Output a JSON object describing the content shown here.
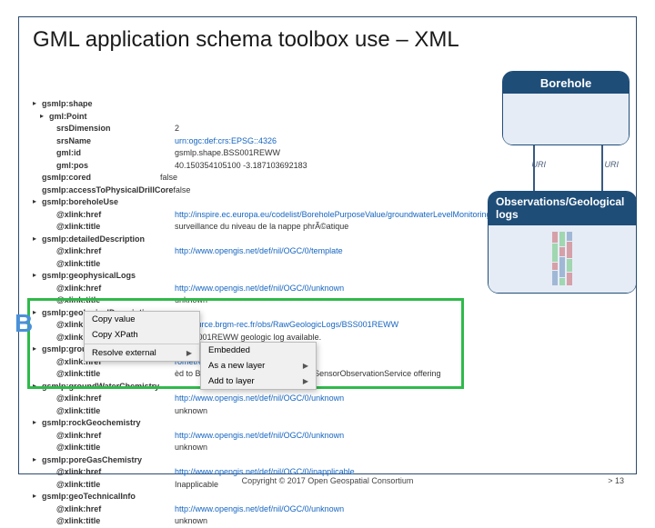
{
  "title": "GML application schema toolbox use – XML",
  "borehole": {
    "label": "Borehole"
  },
  "obs": {
    "label": "Observations/Geological logs"
  },
  "big_b": "B",
  "uri": {
    "l1": "URI",
    "l2": "URI"
  },
  "ctx": {
    "copy_value": "Copy value",
    "copy_xpath": "Copy XPath",
    "resolve_ext": "Resolve external",
    "embedded": "Embedded",
    "new_layer": "As a new layer",
    "add_layer": "Add to layer"
  },
  "attrs": [
    {
      "i": 0,
      "b": "▸",
      "k": "gsmlp:shape",
      "v": ""
    },
    {
      "i": 1,
      "b": "▸",
      "k": "gml:Point",
      "v": ""
    },
    {
      "i": 2,
      "b": "",
      "k": "srsDimension",
      "v": "2"
    },
    {
      "i": 2,
      "b": "",
      "k": "srsName",
      "v": "urn:ogc:def:crs:EPSG::4326",
      "l": true
    },
    {
      "i": 2,
      "b": "",
      "k": "gml:id",
      "v": "gsmlp.shape.BSS001REWW"
    },
    {
      "i": 2,
      "b": "",
      "k": "gml:pos",
      "v": "40.150354105100 -3.187103692183"
    },
    {
      "i": 0,
      "b": "",
      "k": "gsmlp:cored",
      "v": "false"
    },
    {
      "i": 0,
      "b": "",
      "k": "gsmlp:accessToPhysicalDrillCore",
      "v": "false"
    },
    {
      "i": 0,
      "b": "▸",
      "k": "gsmlp:boreholeUse",
      "v": ""
    },
    {
      "i": 2,
      "b": "",
      "k": "@xlink:href",
      "v": "http://inspire.ec.europa.eu/codelist/BoreholePurposeValue/groundwaterLevelMonitoring",
      "l": true
    },
    {
      "i": 2,
      "b": "",
      "k": "@xlink:title",
      "v": "surveillance du niveau de la nappe phrÃ©atique"
    },
    {
      "i": 0,
      "b": "▸",
      "k": "gsmlp:detailedDescription",
      "v": ""
    },
    {
      "i": 2,
      "b": "",
      "k": "@xlink:href",
      "v": "http://www.opengis.net/def/nil/OGC/0/template",
      "l": true
    },
    {
      "i": 2,
      "b": "",
      "k": "@xlink:title",
      "v": ""
    },
    {
      "i": 0,
      "b": "▸",
      "k": "gsmlp:geophysicalLogs",
      "v": ""
    },
    {
      "i": 2,
      "b": "",
      "k": "@xlink:href",
      "v": "http://www.opengis.net/def/nil/OGC/0/unknown",
      "l": true
    },
    {
      "i": 2,
      "b": "",
      "k": "@xlink:title",
      "v": "unknown"
    },
    {
      "i": 0,
      "b": "▸",
      "k": "gsmlp:geologicalDescription",
      "v": ""
    },
    {
      "i": 2,
      "b": "",
      "k": "@xlink:href",
      "v": "/ressource.brgm-rec.fr/obs/RawGeologicLogs/BSS001REWW",
      "l": true
    },
    {
      "i": 2,
      "b": "",
      "k": "@xlink:title",
      "v": "è BSS001REWW geologic log available."
    },
    {
      "i": 0,
      "b": "▸",
      "k": "gsmlp:groundWaterLevel",
      "v": ""
    },
    {
      "i": 2,
      "b": "",
      "k": "@xlink:href",
      "v": "rometre/06124X0083/J-REWW.2",
      "l": true
    },
    {
      "i": 2,
      "b": "",
      "k": "@xlink:title",
      "v": "èd to BSS001REWW. Provides link to SensorObservationService offering"
    },
    {
      "i": 0,
      "b": "▸",
      "k": "gsmlp:groundWaterChemistry",
      "v": ""
    },
    {
      "i": 2,
      "b": "",
      "k": "@xlink:href",
      "v": "http://www.opengis.net/def/nil/OGC/0/unknown",
      "l": true
    },
    {
      "i": 2,
      "b": "",
      "k": "@xlink:title",
      "v": "unknown"
    },
    {
      "i": 0,
      "b": "▸",
      "k": "gsmlp:rockGeochemistry",
      "v": ""
    },
    {
      "i": 2,
      "b": "",
      "k": "@xlink:href",
      "v": "http://www.opengis.net/def/nil/OGC/0/unknown",
      "l": true
    },
    {
      "i": 2,
      "b": "",
      "k": "@xlink:title",
      "v": "unknown"
    },
    {
      "i": 0,
      "b": "▸",
      "k": "gsmlp:poreGasChemistry",
      "v": ""
    },
    {
      "i": 2,
      "b": "",
      "k": "@xlink:href",
      "v": "http://www.opengis.net/def/nil/OGC/0/inapplicable",
      "l": true
    },
    {
      "i": 2,
      "b": "",
      "k": "@xlink:title",
      "v": "Inapplicable"
    },
    {
      "i": 0,
      "b": "▸",
      "k": "gsmlp:geoTechnicalInfo",
      "v": ""
    },
    {
      "i": 2,
      "b": "",
      "k": "@xlink:href",
      "v": "http://www.opengis.net/def/nil/OGC/0/unknown",
      "l": true
    },
    {
      "i": 2,
      "b": "",
      "k": "@xlink:title",
      "v": "unknown"
    }
  ],
  "footer": {
    "copy": "Copyright © 2017 Open Geospatial Consortium",
    "pg": "> 13"
  }
}
